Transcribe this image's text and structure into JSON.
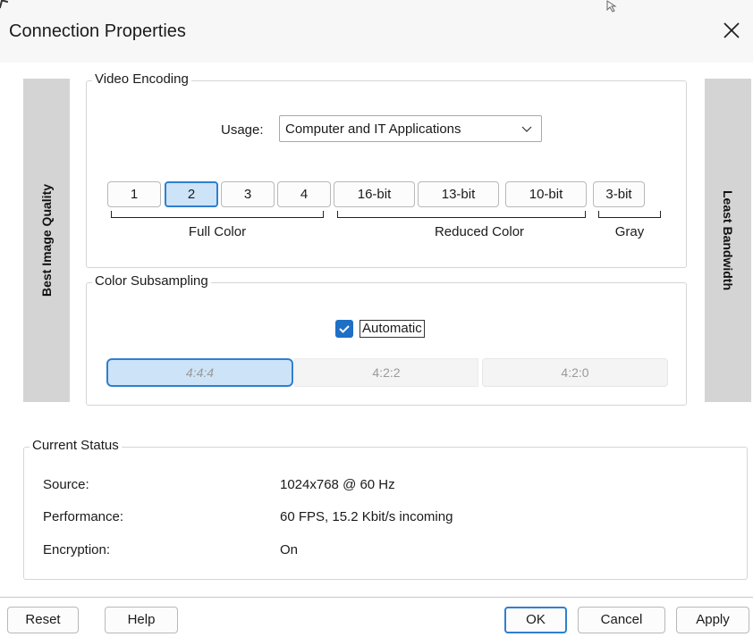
{
  "window": {
    "title": "Connection Properties"
  },
  "side_labels": {
    "left": "Best Image Quality",
    "right": "Least Bandwidth"
  },
  "video_encoding": {
    "group_title": "Video Encoding",
    "usage_label": "Usage:",
    "usage_value": "Computer and IT Applications",
    "quality_buttons": [
      "1",
      "2",
      "3",
      "4",
      "16-bit",
      "13-bit",
      "10-bit",
      "3-bit"
    ],
    "selected_quality": "2",
    "bracket_labels": [
      "Full Color",
      "Reduced Color",
      "Gray"
    ]
  },
  "color_subsampling": {
    "group_title": "Color Subsampling",
    "automatic_label": "Automatic",
    "automatic_checked": true,
    "options": [
      "4:4:4",
      "4:2:2",
      "4:2:0"
    ],
    "selected_option": "4:4:4"
  },
  "current_status": {
    "group_title": "Current Status",
    "rows": [
      {
        "label": "Source:",
        "value": "1024x768 @ 60 Hz"
      },
      {
        "label": "Performance:",
        "value": "60 FPS, 15.2 Kbit/s incoming"
      },
      {
        "label": "Encryption:",
        "value": "On"
      }
    ]
  },
  "footer": {
    "reset": "Reset",
    "help": "Help",
    "ok": "OK",
    "cancel": "Cancel",
    "apply": "Apply"
  },
  "colors": {
    "accent": "#2f7fd0",
    "selected_fill": "#cde3f7",
    "side_bar": "#d4d4d4",
    "checkbox": "#1e6fc6"
  },
  "icons": {
    "close": "close-icon",
    "dropdown": "chevron-down-icon",
    "check": "checkmark-icon"
  }
}
